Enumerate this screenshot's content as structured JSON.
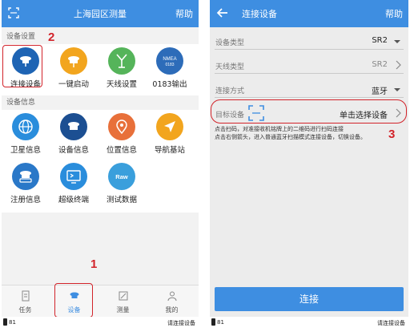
{
  "left": {
    "title": "上海园区测量",
    "help": "帮助",
    "section_device": "设备设置",
    "section_info": "设备信息",
    "tiles_row1": [
      {
        "label": "连接设备",
        "icon": "device-connect-icon",
        "color": "#1e64b4"
      },
      {
        "label": "一键启动",
        "icon": "one-key-start-icon",
        "color": "#f2a51e"
      },
      {
        "label": "天线设置",
        "icon": "antenna-icon",
        "color": "#55b45a"
      },
      {
        "label": "0183输出",
        "icon": "nmea-icon",
        "color": "#2d6cb9",
        "badge_top": "NMEA",
        "badge_bottom": "0183"
      }
    ],
    "tiles_row2": [
      {
        "label": "卫星信息",
        "icon": "globe-icon",
        "color": "#2a8ddc"
      },
      {
        "label": "设备信息",
        "icon": "receiver-icon",
        "color": "#1c4f92"
      },
      {
        "label": "位置信息",
        "icon": "location-pin-icon",
        "color": "#e8703a"
      },
      {
        "label": "导航基站",
        "icon": "navigation-icon",
        "color": "#f2a51e"
      }
    ],
    "tiles_row3": [
      {
        "label": "注册信息",
        "icon": "registration-icon",
        "color": "#2a78c8"
      },
      {
        "label": "超级终端",
        "icon": "terminal-icon",
        "color": "#2a8ddc"
      },
      {
        "label": "测试数据",
        "icon": "raw-data-icon",
        "color": "#3a9fdc",
        "badge": "Raw"
      }
    ],
    "nav": [
      "任务",
      "设备",
      "测量",
      "我的"
    ],
    "annotations": [
      "1",
      "2"
    ],
    "battery": "81",
    "status": "请连接设备"
  },
  "right": {
    "title": "连接设备",
    "help": "帮助",
    "rows": [
      {
        "label": "设备类型",
        "value": "SR2"
      },
      {
        "label": "天线类型",
        "value": "SR2"
      },
      {
        "label": "连接方式",
        "value": "蓝牙"
      },
      {
        "label": "目标设备",
        "value": "单击选择设备"
      }
    ],
    "hint_line1": "点击扫码，对准接收机铭牌上的二维码进行扫码连接",
    "hint_line2": "点击右侧箭头，进入普通蓝牙扫描模式连接设备，切换设备。",
    "connect": "连接",
    "annotation": "3",
    "battery": "81",
    "status": "请连接设备"
  },
  "colors": {
    "accent": "#3e8ee1",
    "annotation": "#d2232a"
  }
}
